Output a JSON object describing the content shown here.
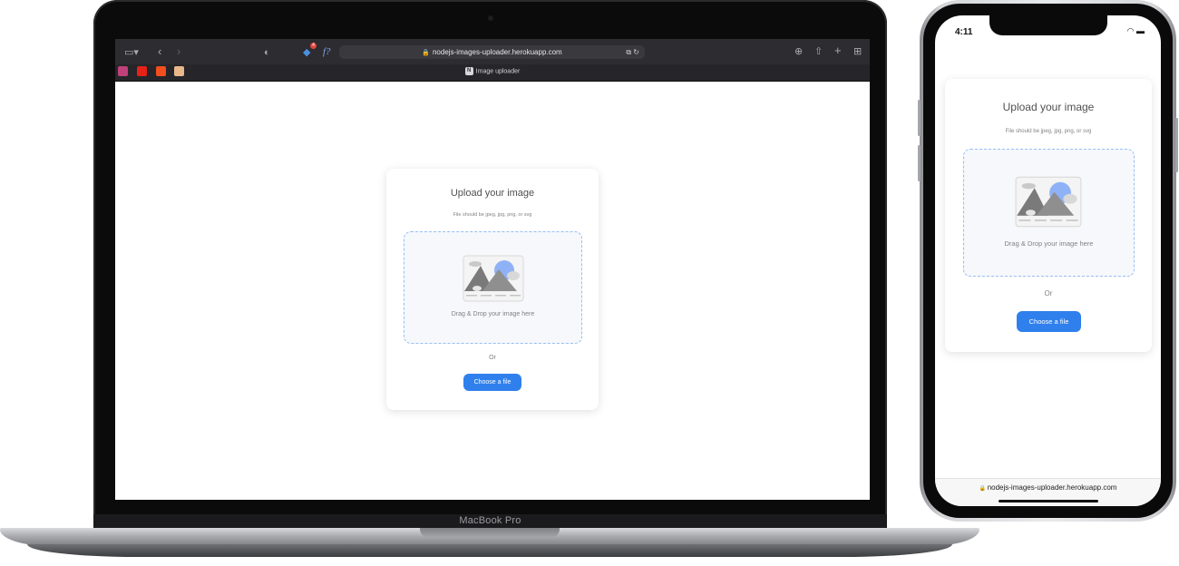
{
  "device_label": "MacBook Pro",
  "browser": {
    "url": "nodejs-images-uploader.herokuapp.com",
    "tab_title": "Image uploader",
    "tab_badge": "N",
    "notification_count": "4"
  },
  "upload": {
    "title": "Upload your image",
    "hint": "File should be jpeg, jpg, png, or svg",
    "drop_text": "Drag & Drop your image here",
    "or_text": "Or",
    "button_label": "Choose a file"
  },
  "phone": {
    "time": "4:11",
    "url": "nodejs-images-uploader.herokuapp.com"
  },
  "colors": {
    "accent": "#2f80ed",
    "drop_bg": "#f6f8fb",
    "drop_border": "#97bef4",
    "browser_toolbar": "#2d2c31"
  }
}
